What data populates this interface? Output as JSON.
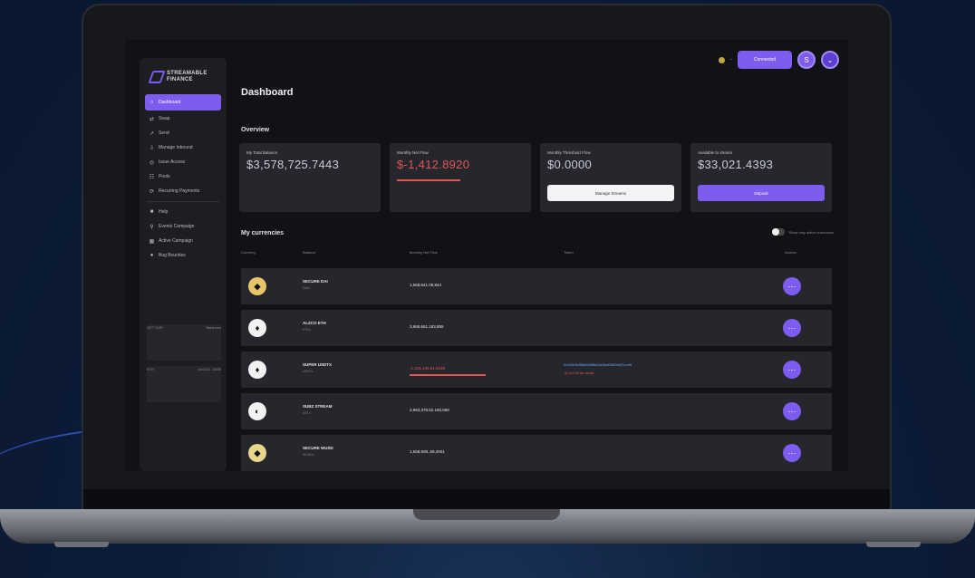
{
  "colors": {
    "accent": "#7e5cf0",
    "negative": "#e05656",
    "link": "#6aa6ff",
    "panel": "#26272c",
    "sidebar": "#1d1e22"
  },
  "brand": {
    "name_line1": "STREAMABLE",
    "name_line2": "FINANCE"
  },
  "sidebar": {
    "items": [
      {
        "label": "Dashboard",
        "icon": "home-icon",
        "glyph": "⌂",
        "active": true
      },
      {
        "label": "Swap",
        "icon": "swap-icon",
        "glyph": "⇄"
      },
      {
        "label": "Send",
        "icon": "send-icon",
        "glyph": "↗"
      },
      {
        "label": "Manage Inbound",
        "icon": "inbound-icon",
        "glyph": "⇩"
      },
      {
        "label": "Issue Access",
        "icon": "key-icon",
        "glyph": "◎"
      },
      {
        "label": "Pools",
        "icon": "pools-icon",
        "glyph": "☷"
      },
      {
        "label": "Recurring Payments",
        "icon": "recurring-icon",
        "glyph": "⟳"
      },
      {
        "label": "Help",
        "icon": "help-icon",
        "glyph": "■"
      },
      {
        "label": "Events Campaign",
        "icon": "events-icon",
        "glyph": "⚲"
      },
      {
        "label": "Active Campaign",
        "icon": "campaign-icon",
        "glyph": "▦"
      },
      {
        "label": "Bug Bounties",
        "icon": "bug-icon",
        "glyph": "●"
      }
    ],
    "footer": {
      "left1": "GET SUP",
      "right1": "Balances",
      "left2": "ETH",
      "right2": "0x1234...5678"
    }
  },
  "topbar": {
    "connect_label": "Connected",
    "avatar_letter": "S",
    "dash": "-"
  },
  "page_title": "Dashboard",
  "overview": {
    "title": "Overview",
    "cards": [
      {
        "label": "My Total Balance",
        "value": "$3,578,725.7443",
        "negative": false
      },
      {
        "label": "Monthly Net Flow",
        "value": "$-1,412.8920",
        "negative": true
      },
      {
        "label": "Monthly Threshold Flow",
        "value": "$0.0000",
        "negative": false,
        "button": "Manage Streams",
        "button_style": "white"
      },
      {
        "label": "Available to stream",
        "value": "$33,021.4393",
        "negative": false,
        "button": "Deposit",
        "button_style": "purple"
      }
    ]
  },
  "currencies": {
    "title": "My currencies",
    "toggle_label": "Show only active currencies",
    "headers": [
      "Currency",
      "Balance",
      "Monthly Net Flow",
      "Token",
      "Actions"
    ],
    "rows": [
      {
        "name": "SECURE DAI",
        "sub": "DAIx",
        "balance": "1,568,541.08,844",
        "negative": false,
        "coin_color": "#e7c76a",
        "coin_glyph": "◆",
        "note": "",
        "note2": ""
      },
      {
        "name": "ALZCO ETH",
        "sub": "ETHx",
        "balance": "3,668,651.183,855",
        "negative": false,
        "coin_color": "#f2f2f2",
        "coin_glyph": "♦",
        "note": "",
        "note2": ""
      },
      {
        "name": "SUPER USDTX",
        "sub": "USDTx",
        "balance": "-1,215,145.51.6185",
        "negative": true,
        "coin_color": "#f2f2f2",
        "coin_glyph": "♦",
        "note": "0x1f4e1b8ffa0e6f8fa0ce5ad0b52af47a.eth",
        "note2": "-$1,412.89 per month"
      },
      {
        "name": "SUBZ STREAM",
        "sub": "SSTx",
        "balance": "2,963,378.52.160,568",
        "negative": false,
        "coin_color": "#f2f2f2",
        "coin_glyph": "◐",
        "note": "",
        "note2": ""
      },
      {
        "name": "SECURE WUSD",
        "sub": "WUSDx",
        "balance": "1,658,938.,69,4001",
        "negative": false,
        "coin_color": "#e7d78a",
        "coin_glyph": "◆",
        "note": "",
        "note2": ""
      }
    ]
  }
}
